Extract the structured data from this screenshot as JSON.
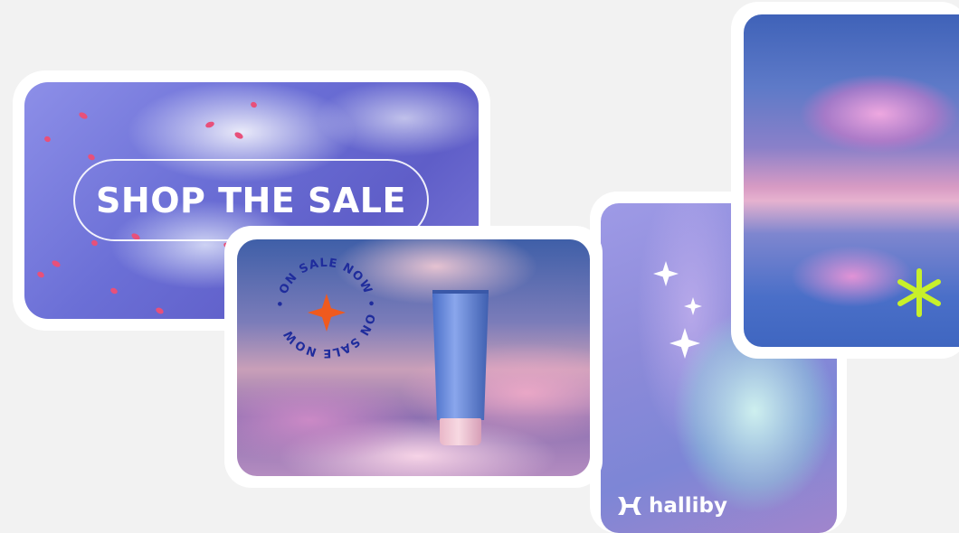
{
  "cards": {
    "shop_sale": {
      "headline": "SHOP THE SALE"
    },
    "product": {
      "badge_text": "• ON SALE NOW • ON SALE NOW",
      "accent_color": "#f05a1e",
      "badge_text_color": "#1f2c9c"
    },
    "brand_card": {
      "logo_icon": "halliby-logo-icon",
      "brand_name": "halliby",
      "sparkle_icons": [
        "sparkle-icon",
        "sparkle-icon",
        "sparkle-icon"
      ]
    },
    "sky": {
      "accent_icon": "asterisk-icon",
      "accent_color": "#c8f02a"
    }
  }
}
